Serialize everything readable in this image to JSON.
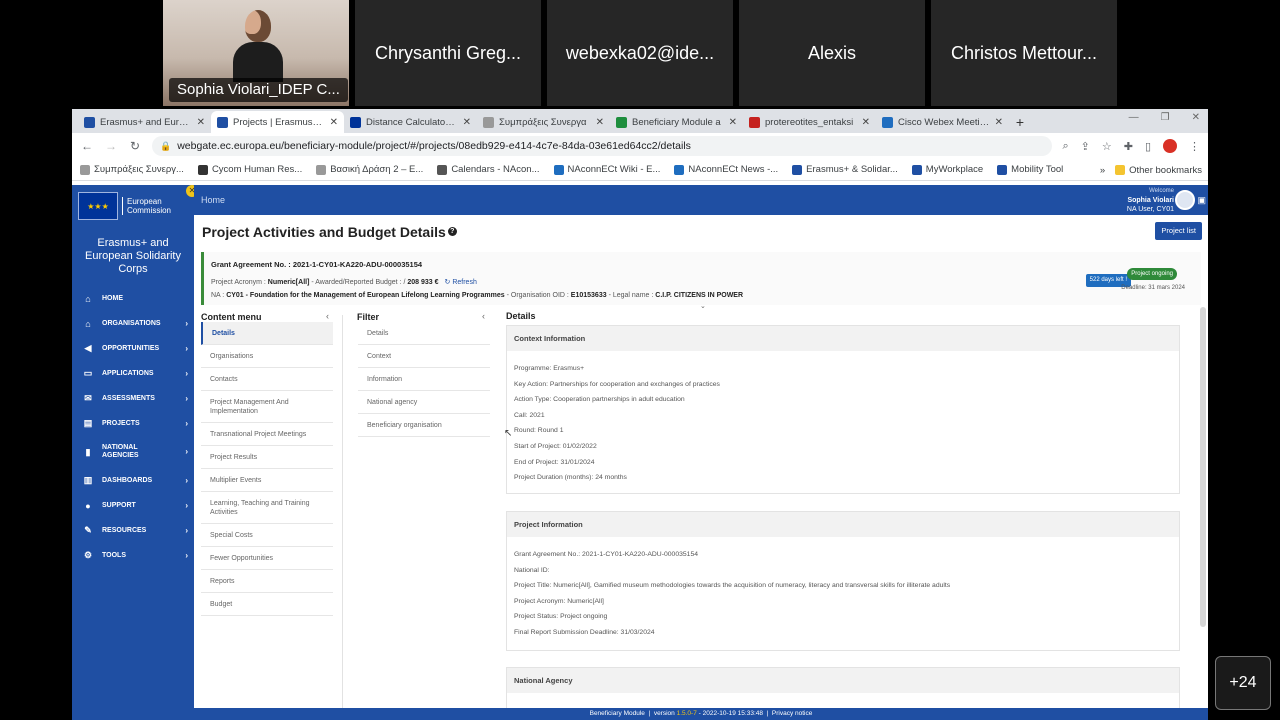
{
  "meeting": {
    "participants": [
      {
        "name": "Sophia Violari_IDEP C...",
        "video": true
      },
      {
        "name": "Chrysanthi Greg..."
      },
      {
        "name": "webexka02@ide..."
      },
      {
        "name": "Alexis"
      },
      {
        "name": "Christos Mettour..."
      }
    ],
    "more_count": "+24"
  },
  "browser": {
    "tabs": [
      {
        "label": "Erasmus+ and Europe",
        "color": "#1f4fa3"
      },
      {
        "label": "Projects | Erasmus+ a",
        "color": "#1f4fa3",
        "active": true
      },
      {
        "label": "Distance Calculator | E",
        "color": "#003399"
      },
      {
        "label": "Συμπράξεις Συνεργα",
        "color": "#999999"
      },
      {
        "label": "Beneficiary Module a",
        "color": "#1e8e3e"
      },
      {
        "label": "protereotites_entaksi",
        "color": "#c5221f"
      },
      {
        "label": "Cisco Webex Meeting",
        "color": "#1f6dbf"
      }
    ],
    "new_tab": "+",
    "url": "webgate.ec.europa.eu/beneficiary-module/project/#/projects/08edb929-e414-4c7e-84da-03e61ed64cc2/details",
    "bookmarks": [
      {
        "label": "Συμπράξεις Συνεργ...",
        "color": "#999999"
      },
      {
        "label": "Cycom Human Res...",
        "color": "#333333"
      },
      {
        "label": "Βασική Δράση 2 – Ε...",
        "color": "#999999"
      },
      {
        "label": "Calendars - NAcon...",
        "color": "#555555"
      },
      {
        "label": "NAconnECt Wiki - E...",
        "color": "#1f6dbf"
      },
      {
        "label": "NAconnECt News -...",
        "color": "#1f6dbf"
      },
      {
        "label": "Erasmus+ & Solidar...",
        "color": "#1f4fa3"
      },
      {
        "label": "MyWorkplace",
        "color": "#1f4fa3"
      },
      {
        "label": "Mobility Tool",
        "color": "#1f4fa3"
      }
    ],
    "bookmarks_more": "»",
    "other_bookmarks": "Other bookmarks"
  },
  "app": {
    "logo": {
      "line1": "European",
      "line2": "Commission"
    },
    "app_name": "Erasmus+ and European Solidarity Corps",
    "menu": [
      {
        "label": "HOME",
        "icon": "⌂",
        "chevron": false
      },
      {
        "label": "ORGANISATIONS",
        "icon": "⌂",
        "chevron": true
      },
      {
        "label": "OPPORTUNITIES",
        "icon": "◀",
        "chevron": true
      },
      {
        "label": "APPLICATIONS",
        "icon": "▭",
        "chevron": true
      },
      {
        "label": "ASSESSMENTS",
        "icon": "✉",
        "chevron": true
      },
      {
        "label": "PROJECTS",
        "icon": "▤",
        "chevron": true
      },
      {
        "label": "NATIONAL AGENCIES",
        "icon": "▮",
        "chevron": true
      },
      {
        "label": "DASHBOARDS",
        "icon": "▥",
        "chevron": true
      },
      {
        "label": "SUPPORT",
        "icon": "●",
        "chevron": true
      },
      {
        "label": "RESOURCES",
        "icon": "✎",
        "chevron": true
      },
      {
        "label": "TOOLS",
        "icon": "⚙",
        "chevron": true
      }
    ],
    "home_link": "Home",
    "user": {
      "welcome": "Welcome",
      "name": "Sophia Violari",
      "role": "NA User, CY01"
    },
    "page_title": "Project Activities and Budget Details",
    "project_list_button": "Project list",
    "grant": {
      "title": "Grant Agreement No. : 2021-1-CY01-KA220-ADU-000035154",
      "acronym_label": "Project Acronym : ",
      "acronym_value": "Numeric[All]",
      "budget_label": " - Awarded/Reported Budget : / ",
      "budget_value": "208 933 €",
      "refresh": "↻ Refresh",
      "na_label": "NA : ",
      "na_value": "CY01 - Foundation for the Management of European Lifelong Learning Programmes",
      "oid_label": " - Organisation OID : ",
      "oid_value": "E10153633",
      "legal_label": " - Legal name : ",
      "legal_value": "C.I.P. CITIZENS IN POWER",
      "days_left": "522 days left !",
      "status": "Project ongoing",
      "deadline": "Deadline: 31 mars 2024"
    },
    "content_menu": {
      "title": "Content menu",
      "items": [
        "Details",
        "Organisations",
        "Contacts",
        "Project Management And Implementation",
        "Transnational Project Meetings",
        "Project Results",
        "Multiplier Events",
        "Learning, Teaching and Training Activities",
        "Special Costs",
        "Fewer Opportunities",
        "Reports",
        "Budget"
      ]
    },
    "filter": {
      "title": "Filter",
      "items": [
        "Details",
        "Context",
        "Information",
        "National agency",
        "Beneficiary organisation"
      ]
    },
    "details": {
      "title": "Details",
      "context": {
        "title": "Context Information",
        "rows": [
          "Programme: Erasmus+",
          "Key Action: Partnerships for cooperation and exchanges of practices",
          "Action Type: Cooperation partnerships in adult education",
          "Call: 2021",
          "Round: Round 1",
          "Start of Project: 01/02/2022",
          "End of Project: 31/01/2024",
          "Project Duration (months): 24 months"
        ]
      },
      "project": {
        "title": "Project Information",
        "rows": [
          "Grant Agreement No.: 2021-1-CY01-KA220-ADU-000035154",
          "National ID:",
          "Project Title: Numeric[All], Gamified museum methodologies towards the acquisition of numeracy, literacy and transversal skills for illiterate adults",
          "Project Acronym: Numeric[All]",
          "Project Status: Project ongoing",
          "Final Report Submission Deadline: 31/03/2024"
        ]
      },
      "na": {
        "title": "National Agency"
      }
    },
    "footer": {
      "module": "Beneficiary Module",
      "version_label": "version",
      "version": "1.5.0-7",
      "build": " - 2022-10-19 15:33:48",
      "privacy": "Privacy notice"
    }
  }
}
